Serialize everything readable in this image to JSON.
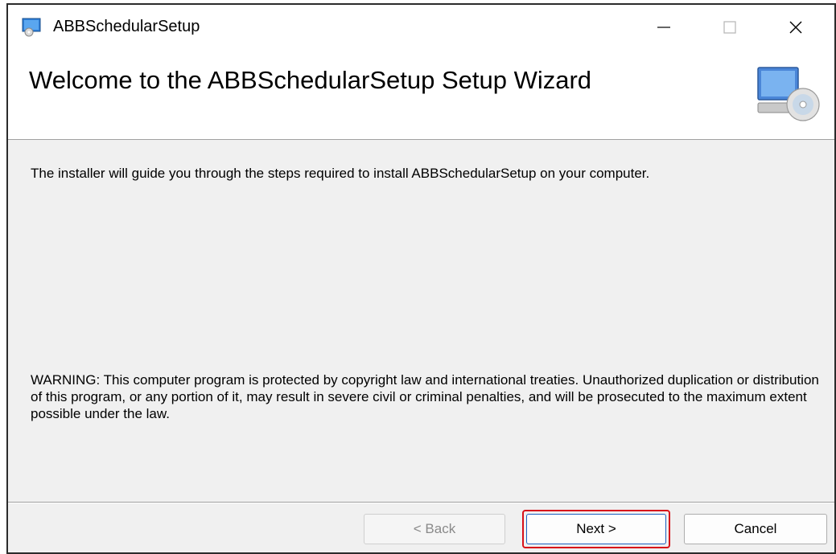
{
  "window": {
    "title": "ABBSchedularSetup",
    "minimize_glyph": "—",
    "maximize_glyph": "□",
    "close_glyph": "✕"
  },
  "banner": {
    "title": "Welcome to the ABBSchedularSetup Setup Wizard",
    "icon": "computer-cd-icon"
  },
  "content": {
    "intro": "The installer will guide you through the steps required to install ABBSchedularSetup on your computer.",
    "warning": "WARNING: This computer program is protected by copyright law and international treaties. Unauthorized duplication or distribution of this program, or any portion of it, may result in severe civil or criminal penalties, and will be prosecuted to the maximum extent possible under the law."
  },
  "buttons": {
    "back_label": "< Back",
    "next_label": "Next >",
    "cancel_label": "Cancel"
  },
  "colors": {
    "highlight": "#d7111a",
    "focus": "#1b5fbf"
  }
}
